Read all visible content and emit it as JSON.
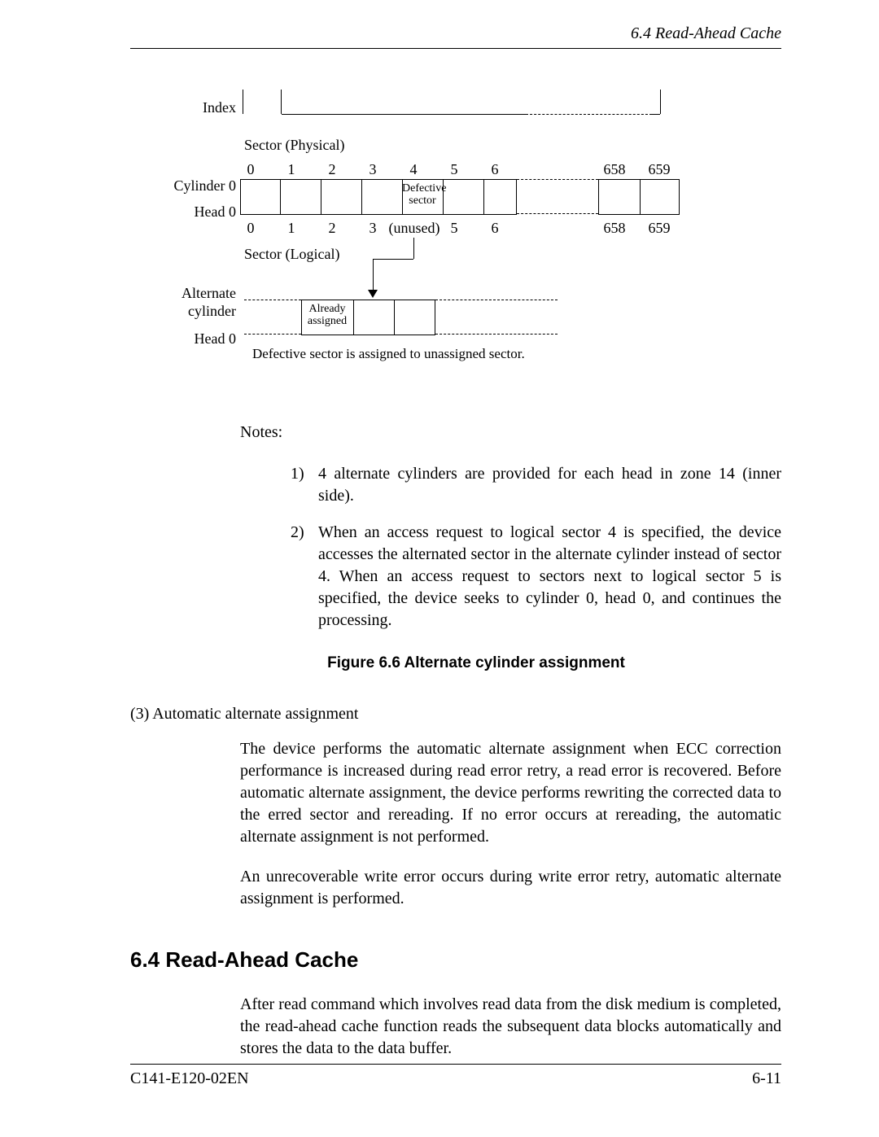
{
  "header": {
    "running": "6.4 Read-Ahead Cache"
  },
  "footer": {
    "left": "C141-E120-02EN",
    "right": "6-11"
  },
  "diagram": {
    "index_label": "Index",
    "sector_phys": "Sector (Physical)",
    "sector_log": "Sector (Logical)",
    "cyl0": "Cylinder 0",
    "head0_a": "Head 0",
    "alt_cyl": "Alternate\ncylinder",
    "head0_b": "Head 0",
    "defective": "Defective\nsector",
    "unused": "(unused)",
    "already": "Already\nassigned",
    "caption": "Defective sector is assigned to unassigned sector.",
    "nums_top": [
      "0",
      "1",
      "2",
      "3",
      "4",
      "5",
      "6",
      "658",
      "659"
    ],
    "nums_bottom": [
      "0",
      "1",
      "2",
      "3",
      "",
      "5",
      "6",
      "658",
      "659"
    ]
  },
  "notes": {
    "heading": "Notes:",
    "items": [
      {
        "n": "1)",
        "t": "4 alternate cylinders are provided for each head in zone 14 (inner side)."
      },
      {
        "n": "2)",
        "t": "When an access request to logical sector 4 is specified, the device accesses the alternated sector in the alternate cylinder instead of sector 4.  When an access request to sectors next to logical sector 5 is specified, the device seeks to cylinder 0, head 0, and continues the processing."
      }
    ]
  },
  "figcaption": "Figure 6.6  Alternate cylinder assignment",
  "sub3": "(3)  Automatic alternate assignment",
  "para1": "The device performs the automatic alternate assignment when ECC correction performance is increased during read error retry, a read error is recovered.  Before automatic alternate assignment, the device performs rewriting the corrected data to the erred sector and rereading.  If no error occurs at rereading, the automatic alternate assignment is not performed.",
  "para2": "An unrecoverable write error occurs during write error retry, automatic alternate assignment is performed.",
  "section": "6.4  Read-Ahead Cache",
  "para3": "After read command which involves read data from the disk medium is completed, the read-ahead cache function reads the subsequent data blocks automatically and stores the data to the data buffer."
}
